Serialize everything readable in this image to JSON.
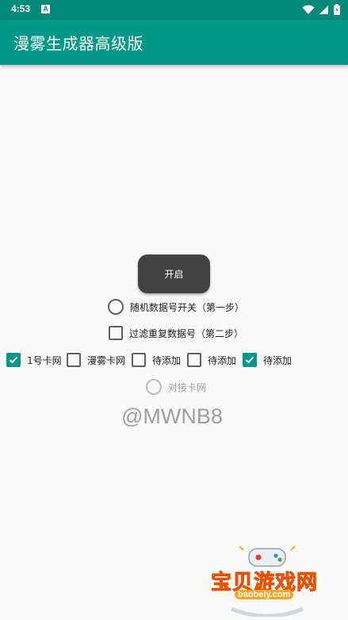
{
  "status_bar": {
    "time": "4:53",
    "notification_icon": "A"
  },
  "app_bar": {
    "title": "漫雾生成器高级版"
  },
  "start_button": {
    "label": "开启"
  },
  "options": {
    "random_switch": {
      "label": "随机数据号开关（第一步）",
      "checked": false
    },
    "filter_duplicates": {
      "label": "过滤重复数据号（第二步）",
      "checked": false
    },
    "card_options": [
      {
        "label": "1号卡网",
        "checked": true
      },
      {
        "label": "漫雾卡网",
        "checked": false
      },
      {
        "label": "待添加",
        "checked": false
      },
      {
        "label": "待添加",
        "checked": false
      },
      {
        "label": "待添加",
        "checked": true
      }
    ],
    "connect_card": {
      "label": "对接卡网",
      "enabled": false
    }
  },
  "watermark": {
    "text": "@MWNB8"
  },
  "site_logo": {
    "name": "宝贝游戏网",
    "url": "baobeiy.com"
  },
  "colors": {
    "primary": "#009688",
    "status_bar": "#00897b",
    "button": "#424242"
  },
  "icons": [
    "wifi-icon",
    "signal-icon",
    "battery-icon",
    "gamepad-icon"
  ]
}
